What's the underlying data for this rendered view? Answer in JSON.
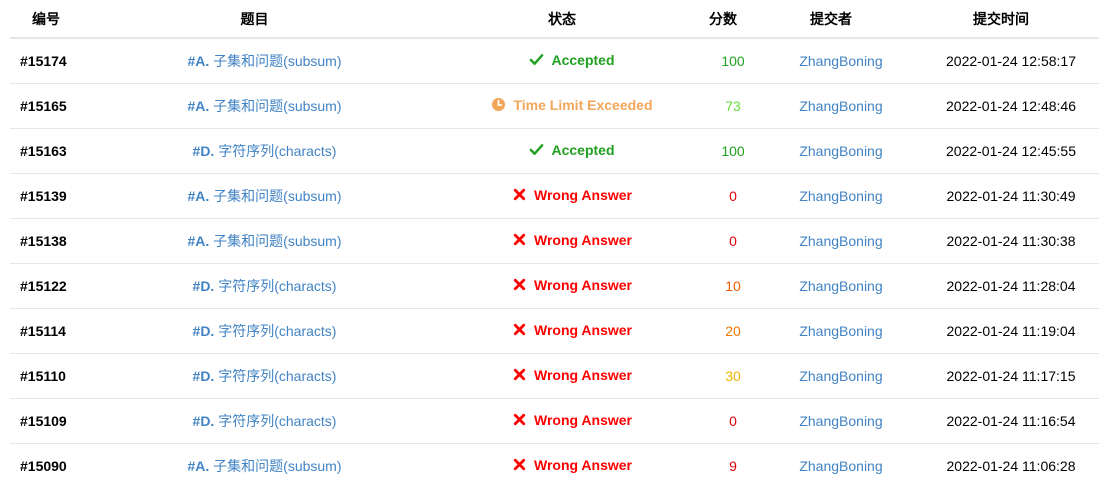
{
  "headers": {
    "id": "编号",
    "problem": "题目",
    "status": "状态",
    "score": "分数",
    "submitter": "提交者",
    "time": "提交时间"
  },
  "colors": {
    "accepted": "#21a021",
    "tle": "#f2a65a",
    "wrong": "#ff0000",
    "link": "#4183c4"
  },
  "rows": [
    {
      "id": "#15174",
      "prefix": "#A.",
      "title": "子集和问题(subsum)",
      "status": "Accepted",
      "status_type": "accepted",
      "score": "100",
      "score_color": "#21a021",
      "user": "ZhangBoning",
      "time": "2022-01-24 12:58:17"
    },
    {
      "id": "#15165",
      "prefix": "#A.",
      "title": "子集和问题(subsum)",
      "status": "Time Limit Exceeded",
      "status_type": "tle",
      "score": "73",
      "score_color": "#66e03a",
      "user": "ZhangBoning",
      "time": "2022-01-24 12:48:46"
    },
    {
      "id": "#15163",
      "prefix": "#D.",
      "title": "字符序列(characts)",
      "status": "Accepted",
      "status_type": "accepted",
      "score": "100",
      "score_color": "#21a021",
      "user": "ZhangBoning",
      "time": "2022-01-24 12:45:55"
    },
    {
      "id": "#15139",
      "prefix": "#A.",
      "title": "子集和问题(subsum)",
      "status": "Wrong Answer",
      "status_type": "wrong",
      "score": "0",
      "score_color": "#e0000a",
      "user": "ZhangBoning",
      "time": "2022-01-24 11:30:49"
    },
    {
      "id": "#15138",
      "prefix": "#A.",
      "title": "子集和问题(subsum)",
      "status": "Wrong Answer",
      "status_type": "wrong",
      "score": "0",
      "score_color": "#e0000a",
      "user": "ZhangBoning",
      "time": "2022-01-24 11:30:38"
    },
    {
      "id": "#15122",
      "prefix": "#D.",
      "title": "字符序列(characts)",
      "status": "Wrong Answer",
      "status_type": "wrong",
      "score": "10",
      "score_color": "#f05a00",
      "user": "ZhangBoning",
      "time": "2022-01-24 11:28:04"
    },
    {
      "id": "#15114",
      "prefix": "#D.",
      "title": "字符序列(characts)",
      "status": "Wrong Answer",
      "status_type": "wrong",
      "score": "20",
      "score_color": "#f07800",
      "user": "ZhangBoning",
      "time": "2022-01-24 11:19:04"
    },
    {
      "id": "#15110",
      "prefix": "#D.",
      "title": "字符序列(characts)",
      "status": "Wrong Answer",
      "status_type": "wrong",
      "score": "30",
      "score_color": "#f0b400",
      "user": "ZhangBoning",
      "time": "2022-01-24 11:17:15"
    },
    {
      "id": "#15109",
      "prefix": "#D.",
      "title": "字符序列(characts)",
      "status": "Wrong Answer",
      "status_type": "wrong",
      "score": "0",
      "score_color": "#e0000a",
      "user": "ZhangBoning",
      "time": "2022-01-24 11:16:54"
    },
    {
      "id": "#15090",
      "prefix": "#A.",
      "title": "子集和问题(subsum)",
      "status": "Wrong Answer",
      "status_type": "wrong",
      "score": "9",
      "score_color": "#e0000a",
      "user": "ZhangBoning",
      "time": "2022-01-24 11:06:28"
    }
  ]
}
